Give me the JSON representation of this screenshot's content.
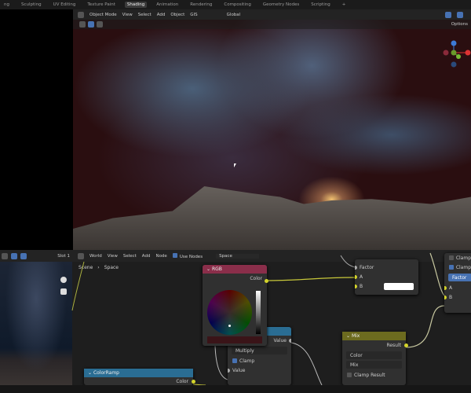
{
  "workspace_tabs": [
    "ng",
    "Sculpting",
    "UV Editing",
    "Texture Paint",
    "Shading",
    "Animation",
    "Rendering",
    "Compositing",
    "Geometry Nodes",
    "Scripting",
    "+"
  ],
  "active_tab": "Shading",
  "viewport": {
    "mode": "Object Mode",
    "menus": [
      "View",
      "Select",
      "Add",
      "Object",
      "GIS"
    ],
    "orientation": "Global",
    "options": "Options"
  },
  "image_editor": {
    "slot": "Slot 1"
  },
  "node_editor": {
    "type": "World",
    "menus": [
      "View",
      "Select",
      "Add",
      "Node"
    ],
    "use_nodes": "Use Nodes",
    "world_name": "Space",
    "breadcrumb": [
      "Scene",
      "Space"
    ]
  },
  "nodes": {
    "rgb": {
      "title": "RGB",
      "output": "Color",
      "color": "#8a2e4a"
    },
    "math": {
      "output": "Value",
      "operation": "Multiply",
      "clamp": "Clamp",
      "input": "Value",
      "color": "#2a6d93"
    },
    "mixA": {
      "inputs": [
        "Factor",
        "A",
        "B"
      ]
    },
    "mix": {
      "title": "Mix",
      "output": "Result",
      "data_type": "Color",
      "blend": "Mix",
      "clamp": "Clamp Result",
      "color": "#6c6b1f"
    },
    "right": {
      "clamp1": "Clamp",
      "clamp2": "Clamp",
      "factor": "Factor",
      "inputs": [
        "A",
        "B"
      ]
    },
    "colorramp": {
      "title": "ColorRamp",
      "output": "Color",
      "color": "#2a6d93"
    }
  }
}
